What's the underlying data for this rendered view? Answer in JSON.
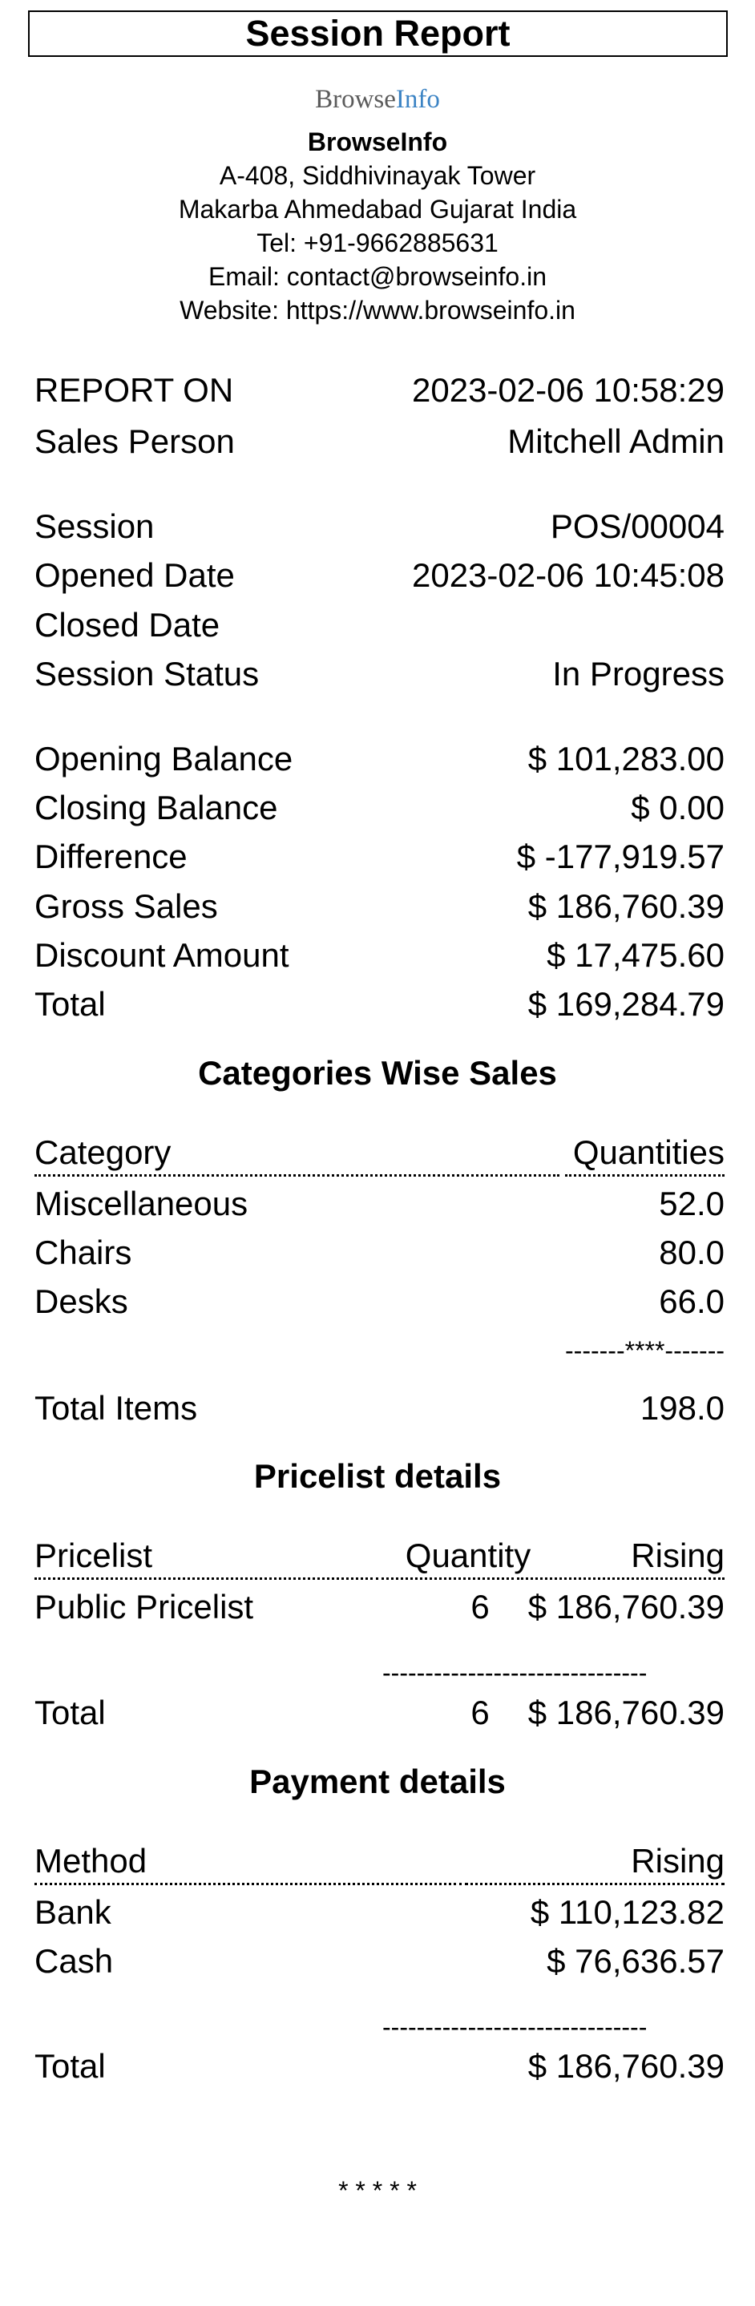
{
  "title": "Session Report",
  "logo": {
    "part1": "Browse",
    "part2": "Info"
  },
  "company": {
    "name": "BrowseInfo",
    "address1": "A-408, Siddhivinayak Tower",
    "address2": "Makarba Ahmedabad Gujarat India",
    "tel": "Tel: +91-9662885631",
    "email": "Email: contact@browseinfo.in",
    "website": "Website: https://www.browseinfo.in"
  },
  "report": {
    "report_on_label": "REPORT ON",
    "report_on_value": "2023-02-06 10:58:29",
    "sales_person_label": "Sales Person",
    "sales_person_value": "Mitchell Admin"
  },
  "session": {
    "session_label": "Session",
    "session_value": "POS/00004",
    "opened_label": "Opened Date",
    "opened_value": "2023-02-06 10:45:08",
    "closed_label": "Closed Date",
    "closed_value": "",
    "status_label": "Session Status",
    "status_value": "In Progress"
  },
  "balances": {
    "opening_label": "Opening Balance",
    "opening_value": "$ 101,283.00",
    "closing_label": "Closing Balance",
    "closing_value": "$ 0.00",
    "difference_label": "Difference",
    "difference_value": "$ -177,919.57",
    "gross_label": "Gross Sales",
    "gross_value": "$ 186,760.39",
    "discount_label": "Discount Amount",
    "discount_value": "$ 17,475.60",
    "total_label": "Total",
    "total_value": "$ 169,284.79"
  },
  "categories": {
    "title": "Categories Wise Sales",
    "headers": [
      "Category",
      "Quantities"
    ],
    "rows": [
      {
        "name": "Miscellaneous",
        "qty": "52.0"
      },
      {
        "name": "Chairs",
        "qty": "80.0"
      },
      {
        "name": "Desks",
        "qty": "66.0"
      }
    ],
    "separator": "-------****-------",
    "total_label": "Total Items",
    "total_value": "198.0"
  },
  "pricelist": {
    "title": "Pricelist details",
    "headers": [
      "Pricelist",
      "Quantity",
      "Rising"
    ],
    "rows": [
      {
        "name": "Public Pricelist",
        "qty": "6",
        "amount": "$ 186,760.39"
      }
    ],
    "separator": "-------------------------------",
    "total_label": "Total",
    "total_qty": "6",
    "total_amount": "$ 186,760.39"
  },
  "payments": {
    "title": "Payment details",
    "headers": [
      "Method",
      "Rising"
    ],
    "rows": [
      {
        "method": "Bank",
        "amount": "$ 110,123.82"
      },
      {
        "method": "Cash",
        "amount": "$ 76,636.57"
      }
    ],
    "separator": "-------------------------------",
    "total_label": "Total",
    "total_amount": "$ 186,760.39"
  },
  "footer": "* * * * *"
}
